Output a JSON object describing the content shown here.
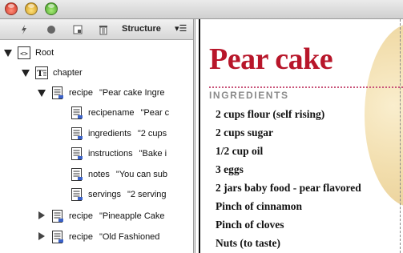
{
  "window": {
    "controls": [
      "close",
      "minimize",
      "zoom"
    ]
  },
  "structure_panel": {
    "title": "Structure",
    "toolbar_icons": [
      "add-attribute-icon",
      "record-icon",
      "snippet-icon",
      "trash-icon"
    ],
    "menu_glyph": "▾☰"
  },
  "tree": [
    {
      "level": 0,
      "expanded": true,
      "icon": "xml-root-icon",
      "label": "Root",
      "value": ""
    },
    {
      "level": 1,
      "expanded": true,
      "icon": "story-element-icon",
      "label": "chapter",
      "value": ""
    },
    {
      "level": 2,
      "expanded": true,
      "icon": "text-element-icon",
      "label": "recipe",
      "value": "\"Pear cake Ingre"
    },
    {
      "level": 3,
      "expanded": null,
      "icon": "text-element-icon",
      "label": "recipename",
      "value": "\"Pear c"
    },
    {
      "level": 3,
      "expanded": null,
      "icon": "text-element-icon",
      "label": "ingredients",
      "value": "\"2 cups"
    },
    {
      "level": 3,
      "expanded": null,
      "icon": "text-element-icon",
      "label": "instructions",
      "value": "\"Bake i"
    },
    {
      "level": 3,
      "expanded": null,
      "icon": "text-element-icon",
      "label": "notes",
      "value": "\"You can sub"
    },
    {
      "level": 3,
      "expanded": null,
      "icon": "text-element-icon",
      "label": "servings",
      "value": "\"2 serving"
    },
    {
      "level": 2,
      "expanded": false,
      "icon": "text-element-icon",
      "label": "recipe",
      "value": "\"Pineapple Cake"
    },
    {
      "level": 2,
      "expanded": false,
      "icon": "text-element-icon",
      "label": "recipe",
      "value": "\"Old Fashioned"
    }
  ],
  "document": {
    "title": "Pear cake",
    "section_heading": "INGREDIENTS",
    "ingredients": [
      "2 cups flour (self rising)",
      "2 cups sugar",
      "1/2 cup oil",
      "3 eggs",
      "2 jars baby food - pear flavored",
      "Pinch of cinnamon",
      "Pinch of cloves",
      "Nuts (to taste)"
    ]
  },
  "colors": {
    "title_red": "#b8162a",
    "heading_gray": "#8a8a8a",
    "dotted_rule": "#c9557a"
  }
}
